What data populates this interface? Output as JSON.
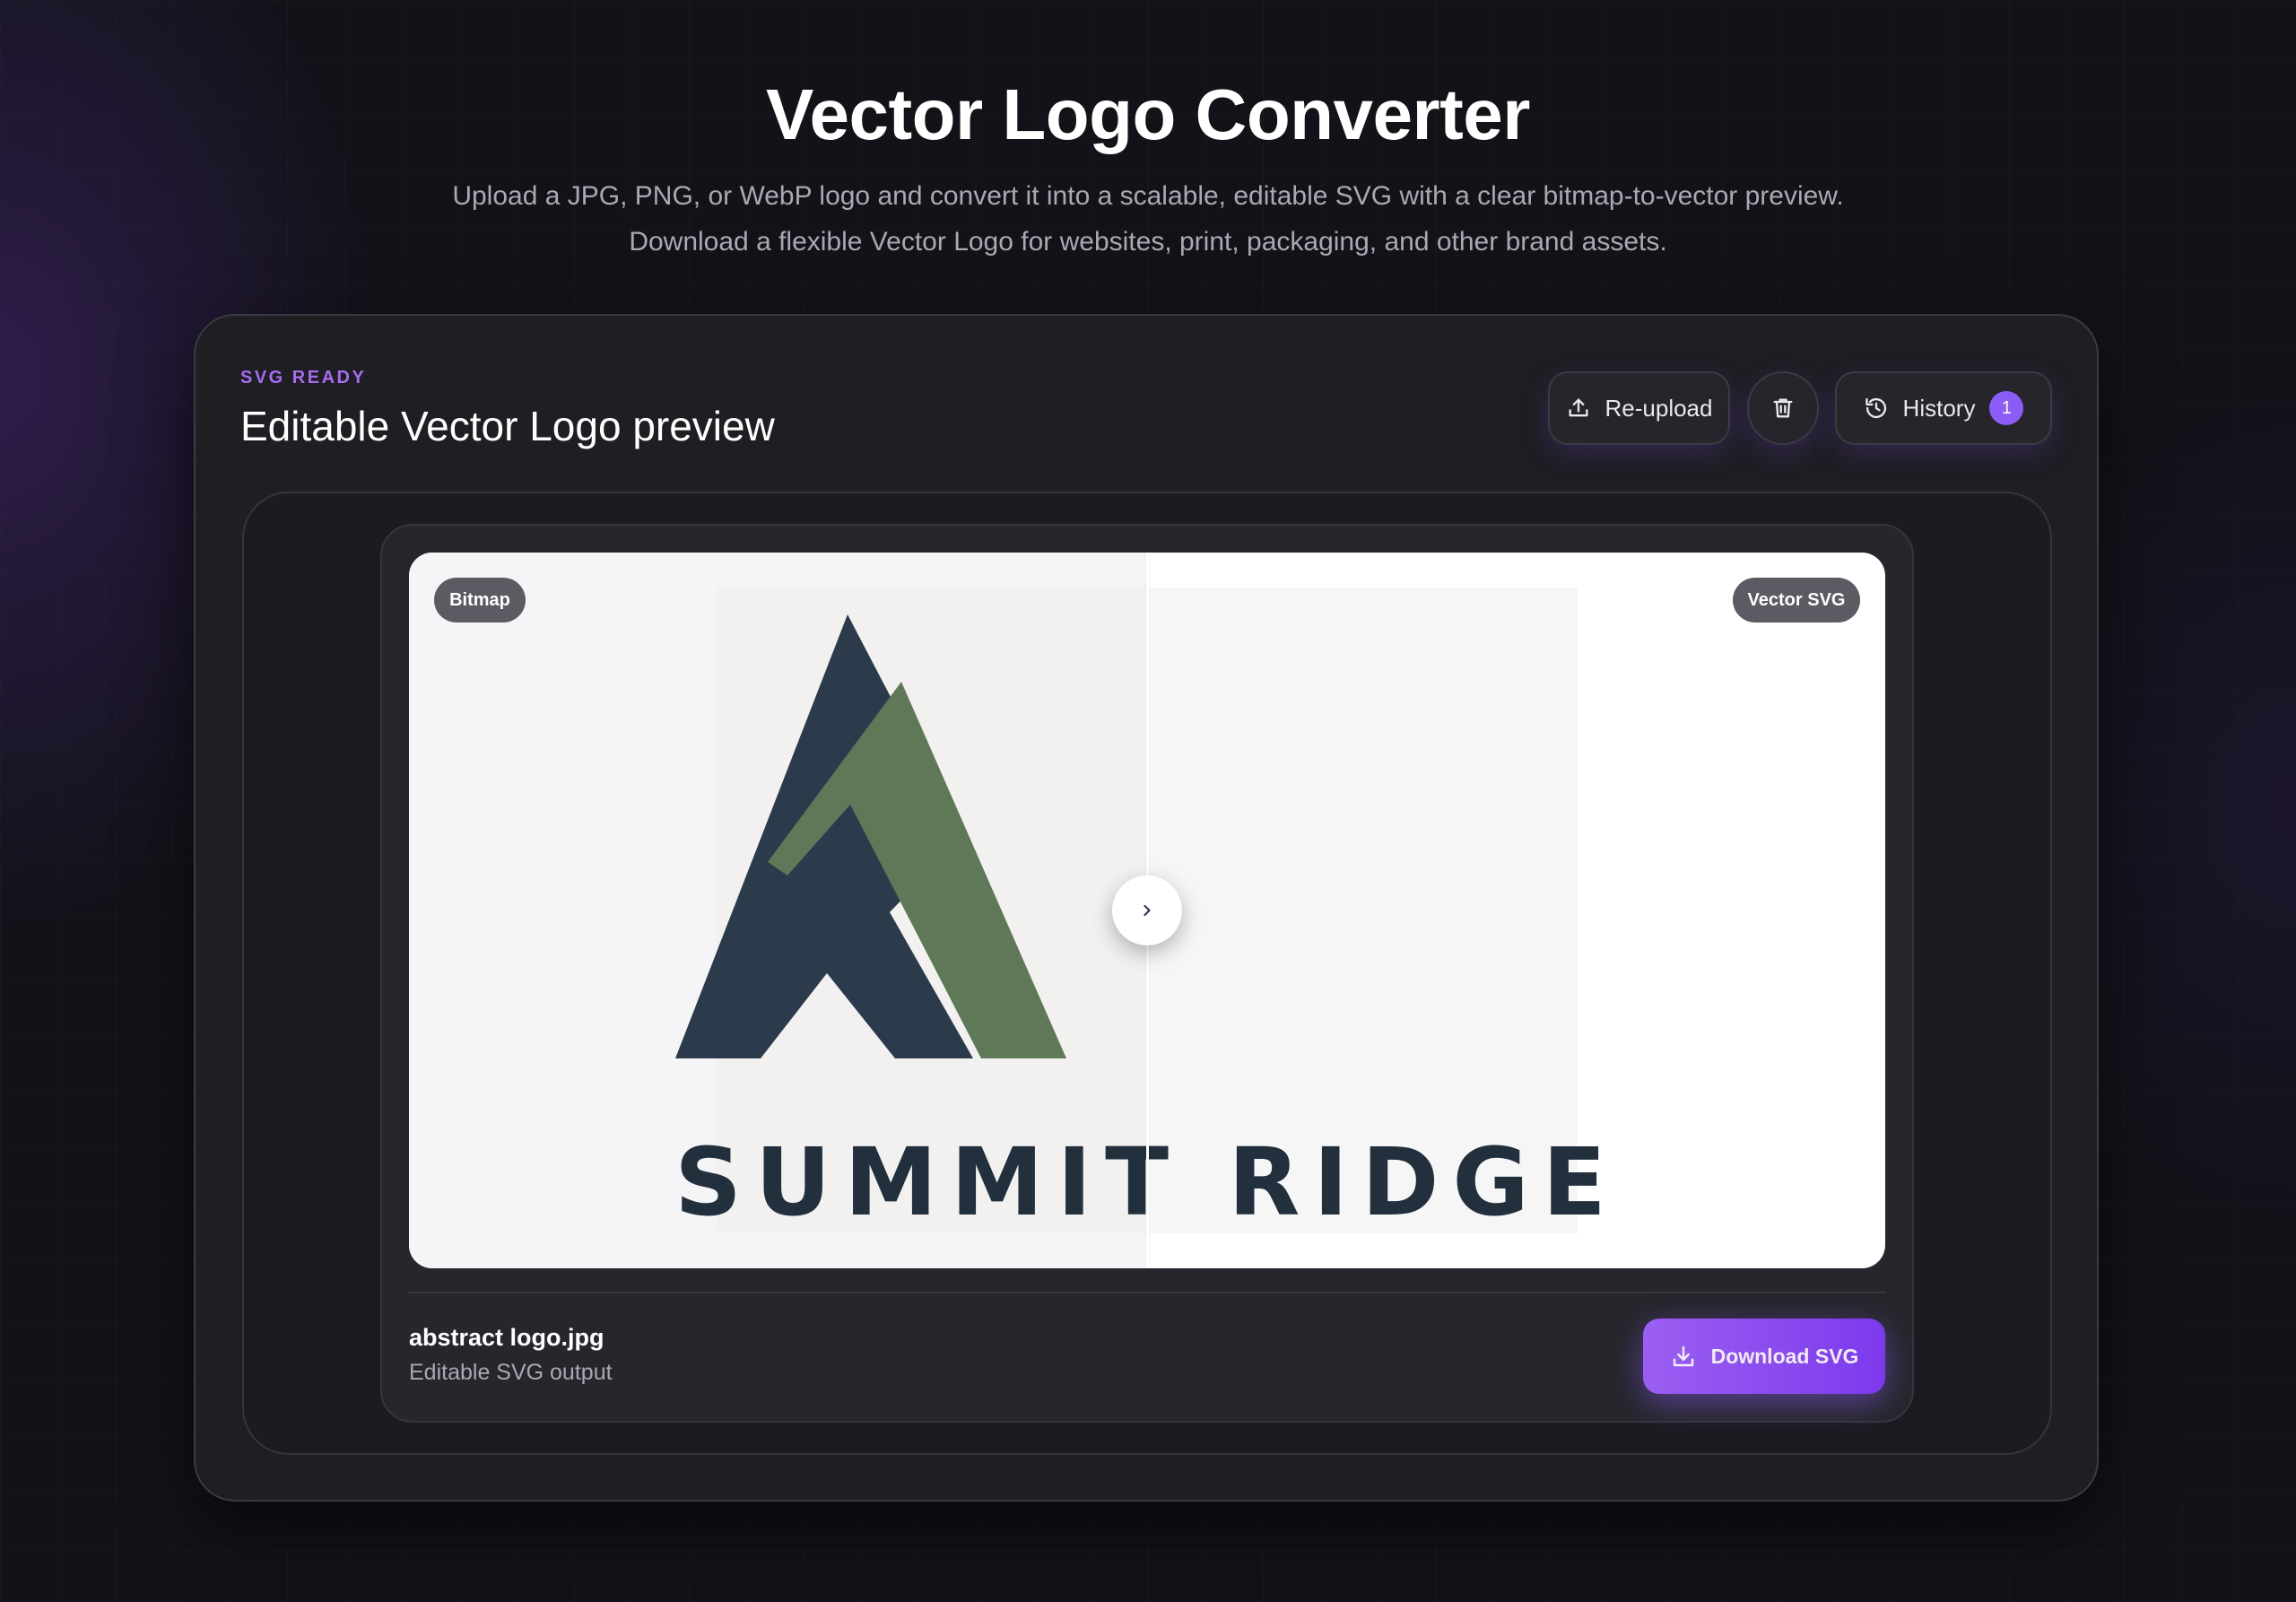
{
  "page": {
    "title": "Vector Logo Converter",
    "subtitle_line1": "Upload a JPG, PNG, or WebP logo and convert it into a scalable, editable SVG with a clear bitmap-to-vector preview.",
    "subtitle_line2": "Download a flexible Vector Logo for websites, print, packaging, and other brand assets."
  },
  "card": {
    "status": "SVG READY",
    "title": "Editable Vector Logo preview",
    "actions": {
      "reupload_label": "Re-upload",
      "delete_icon": "trash-icon",
      "history_label": "History",
      "history_count": "1"
    }
  },
  "preview": {
    "left_tag": "Bitmap",
    "right_tag": "Vector SVG",
    "logo_wordmark": "SUMMIT RIDGE",
    "slider_position": 0.5,
    "colors": {
      "navy": "#2b3b4b",
      "green": "#5f7858",
      "text": "#22303d"
    }
  },
  "file": {
    "name": "abstract logo.jpg",
    "description": "Editable SVG output",
    "download_label": "Download SVG"
  },
  "theme": {
    "accent": "#8b5cf6",
    "background": "#121218"
  }
}
